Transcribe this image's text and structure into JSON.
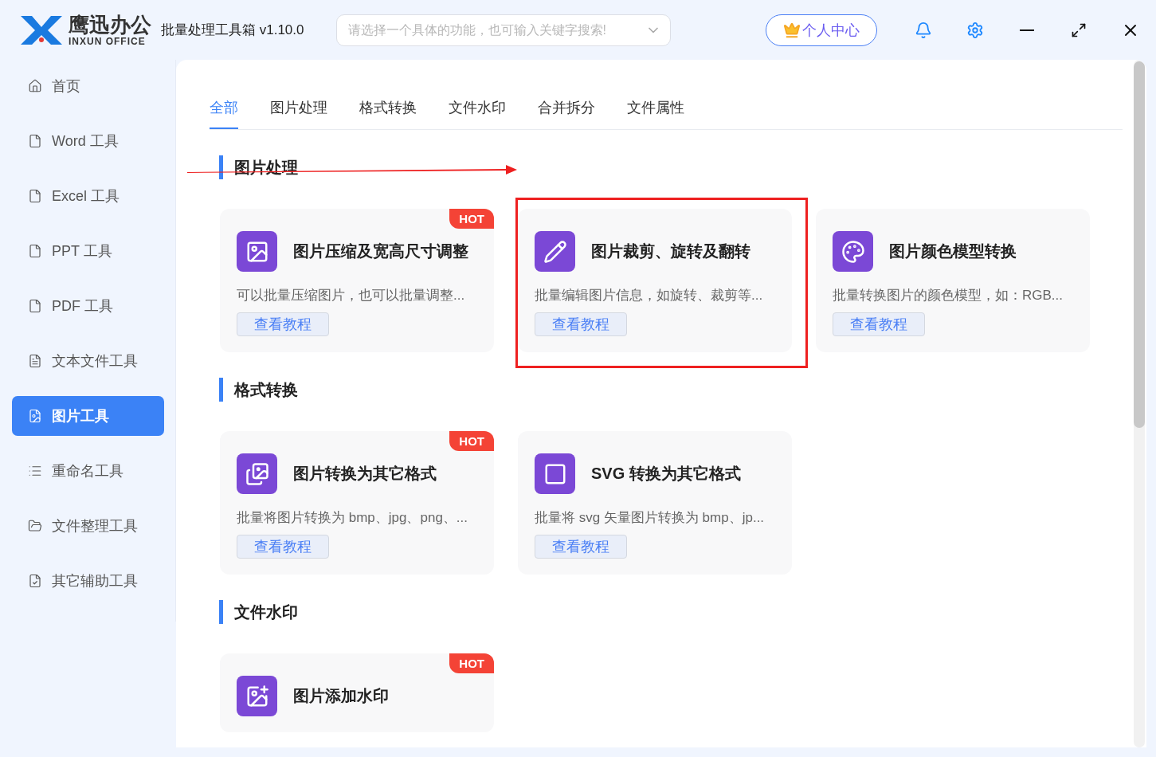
{
  "app": {
    "brand_cn": "鹰迅办公",
    "brand_en": "INXUN OFFICE",
    "title": "批量处理工具箱 v1.10.0"
  },
  "search": {
    "placeholder": "请选择一个具体的功能，也可输入关键字搜索!"
  },
  "account_button": "个人中心",
  "sidebar": {
    "items": [
      {
        "label": "首页",
        "kind": "home",
        "selected": false
      },
      {
        "label": "Word 工具",
        "kind": "file",
        "selected": false
      },
      {
        "label": "Excel 工具",
        "kind": "file",
        "selected": false
      },
      {
        "label": "PPT 工具",
        "kind": "file",
        "selected": false
      },
      {
        "label": "PDF 工具",
        "kind": "file",
        "selected": false
      },
      {
        "label": "文本文件工具",
        "kind": "text",
        "selected": false
      },
      {
        "label": "图片工具",
        "kind": "image",
        "selected": true
      },
      {
        "label": "重命名工具",
        "kind": "list",
        "selected": false
      },
      {
        "label": "文件整理工具",
        "kind": "folder",
        "selected": false
      },
      {
        "label": "其它辅助工具",
        "kind": "check",
        "selected": false
      }
    ]
  },
  "tabs": [
    {
      "label": "全部",
      "selected": true
    },
    {
      "label": "图片处理",
      "selected": false
    },
    {
      "label": "格式转换",
      "selected": false
    },
    {
      "label": "文件水印",
      "selected": false
    },
    {
      "label": "合并拆分",
      "selected": false
    },
    {
      "label": "文件属性",
      "selected": false
    }
  ],
  "sections": [
    {
      "title": "图片处理",
      "arrow": true,
      "cards": [
        {
          "title": "图片压缩及宽高尺寸调整",
          "description": "可以批量压缩图片，也可以批量调整...",
          "button": "查看教程",
          "badge": "HOT",
          "kind": "compress",
          "highlighted": false
        },
        {
          "title": "图片裁剪、旋转及翻转",
          "description": "批量编辑图片信息，如旋转、裁剪等...",
          "button": "查看教程",
          "kind": "edit",
          "highlighted": true
        },
        {
          "title": "图片颜色模型转换",
          "description": "批量转换图片的颜色模型，如：RGB...",
          "button": "查看教程",
          "kind": "palette",
          "highlighted": false
        }
      ]
    },
    {
      "title": "格式转换",
      "arrow": false,
      "cards": [
        {
          "title": "图片转换为其它格式",
          "description": "批量将图片转换为 bmp、jpg、png、...",
          "button": "查看教程",
          "badge": "HOT",
          "kind": "convert",
          "highlighted": false
        },
        {
          "title": "SVG 转换为其它格式",
          "description": "批量将 svg 矢量图片转换为 bmp、jp...",
          "button": "查看教程",
          "kind": "svg",
          "highlighted": false
        }
      ]
    },
    {
      "title": "文件水印",
      "arrow": false,
      "cards": [
        {
          "title": "图片添加水印",
          "badge": "HOT",
          "kind": "watermark",
          "highlighted": false
        }
      ]
    }
  ]
}
